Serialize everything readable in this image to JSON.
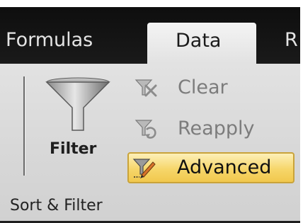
{
  "tabs": {
    "formulas": "Formulas",
    "data": "Data",
    "next_partial": "R"
  },
  "ribbon": {
    "filter_label": "Filter",
    "clear_label": "Clear",
    "reapply_label": "Reapply",
    "advanced_label": "Advanced",
    "group_label": "Sort & Filter"
  },
  "icons": {
    "filter": "funnel-icon",
    "clear": "clear-filter-icon",
    "reapply": "reapply-filter-icon",
    "advanced": "advanced-filter-icon"
  },
  "colors": {
    "tab_bar": "#111111",
    "ribbon_bg": "#dcdcdc",
    "highlight": "#f6d66a",
    "disabled_text": "#7c7c7c"
  }
}
